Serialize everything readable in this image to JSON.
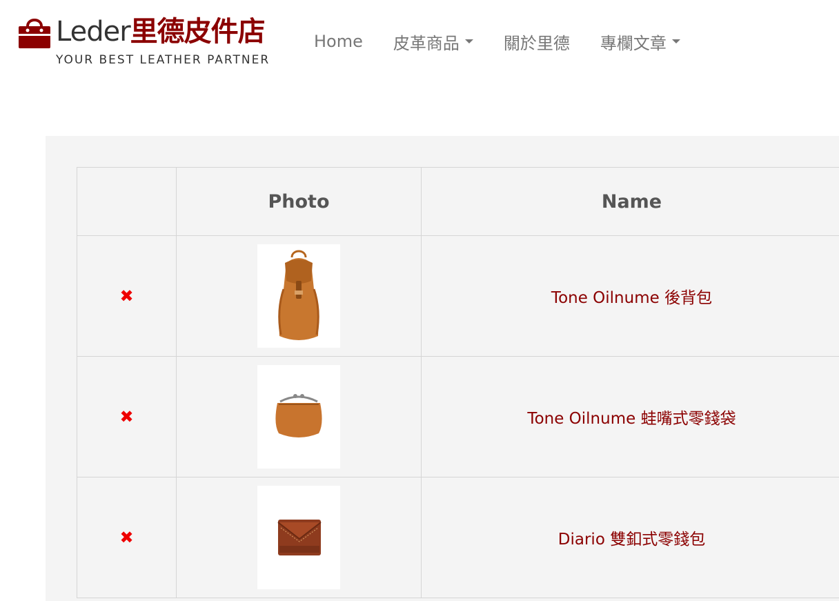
{
  "brand": {
    "name_en": "Leder",
    "name_zh": "里德皮件店",
    "tagline": "YOUR BEST LEATHER PARTNER",
    "accent_color": "#8b0000"
  },
  "nav": [
    {
      "label": "Home",
      "dropdown": false
    },
    {
      "label": "皮革商品",
      "dropdown": true
    },
    {
      "label": "關於里德",
      "dropdown": false
    },
    {
      "label": "專欄文章",
      "dropdown": true
    }
  ],
  "cart": {
    "headers": {
      "remove": "",
      "photo": "Photo",
      "name": "Name"
    },
    "remove_icon": "✖",
    "items": [
      {
        "name": "Tone Oilnume 後背包",
        "photo_icon": "backpack-photo"
      },
      {
        "name": "Tone Oilnume 蛙嘴式零錢袋",
        "photo_icon": "coin-purse-photo"
      },
      {
        "name": "Diario 雙釦式零錢包",
        "photo_icon": "wallet-photo"
      }
    ]
  }
}
